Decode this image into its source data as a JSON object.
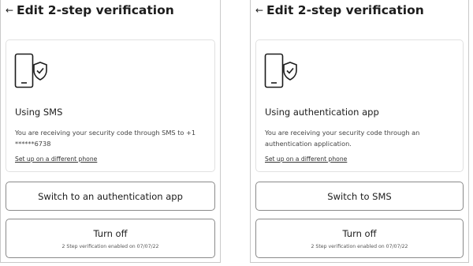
{
  "panels": [
    {
      "header": {
        "back_glyph": "←",
        "title": "Edit 2-step verification"
      },
      "card": {
        "icon": "phone-shield-check-icon",
        "title": "Using SMS",
        "description": "You are receiving your security code through SMS to +1 ******6738",
        "link": "Set up on a different phone"
      },
      "switch_button": {
        "label": "Switch to an authentication app"
      },
      "turn_off_button": {
        "label": "Turn off",
        "subtext": "2 Step verification enabled on 07/07/22"
      }
    },
    {
      "header": {
        "back_glyph": "←",
        "title": "Edit 2-step verification"
      },
      "card": {
        "icon": "phone-shield-check-icon",
        "title": "Using authentication app",
        "description": "You are receiving your security code through an authentication application.",
        "link": "Set up on a different phone"
      },
      "switch_button": {
        "label": "Switch to SMS"
      },
      "turn_off_button": {
        "label": "Turn off",
        "subtext": "2 Step verification enabled on 07/07/22"
      }
    }
  ]
}
